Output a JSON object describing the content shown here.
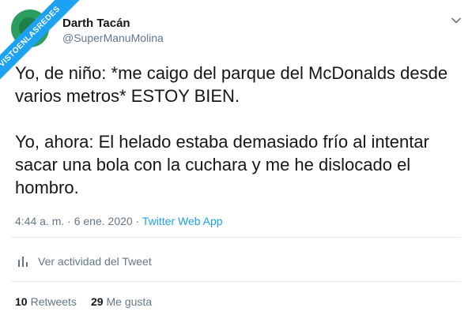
{
  "watermark": {
    "text": "VISTOENLASREDES"
  },
  "tweet": {
    "display_name": "Darth Tacán",
    "handle": "@SuperManuMolina",
    "text": "Yo, de niño: *me caigo del parque del McDonalds desde varios metros* ESTOY BIEN.\n\nYo, ahora: El helado estaba demasiado frío al intentar sacar una bola con la cuchara y me he dislocado el hombro.",
    "time": "4:44 a. m.",
    "separator1": " · ",
    "date": "6 ene. 2020",
    "separator2": " · ",
    "source": "Twitter Web App",
    "activity_label": "Ver actividad del Tweet",
    "retweets_count": "10",
    "retweets_label": "Retweets",
    "likes_count": "29",
    "likes_label": "Me gusta"
  },
  "colors": {
    "accent": "#1da1f2",
    "muted": "#657786",
    "text": "#14171a",
    "divider": "#e6ecf0"
  },
  "icons": {
    "caret": "chevron-down-icon",
    "activity": "bar-chart-icon"
  }
}
